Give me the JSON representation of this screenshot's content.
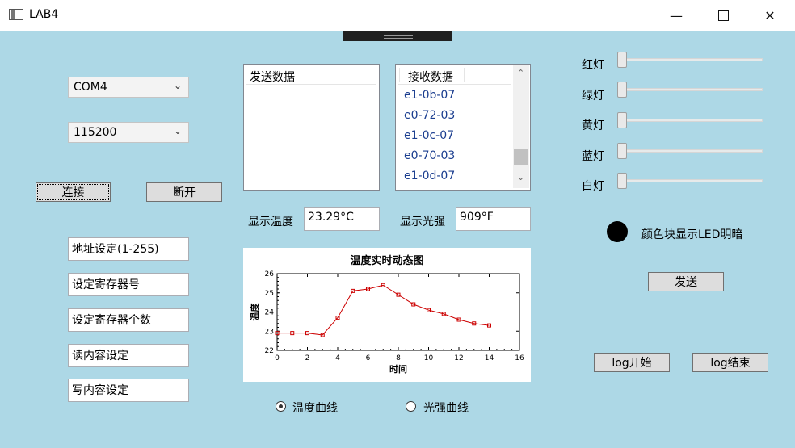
{
  "window": {
    "title": "LAB4"
  },
  "serial": {
    "port": "COM4",
    "baud": "115200",
    "connect_label": "连接",
    "disconnect_label": "断开"
  },
  "fields": {
    "address": "地址设定(1-255)",
    "register": "设定寄存器号",
    "register_count": "设定寄存器个数",
    "read_content": "读内容设定",
    "write_content": "写内容设定"
  },
  "send_list": {
    "header": "发送数据"
  },
  "receive_list": {
    "header": "接收数据",
    "items": [
      "e1-0b-07",
      "e0-72-03",
      "e1-0c-07",
      "e0-70-03",
      "e1-0d-07"
    ]
  },
  "readouts": {
    "temp_label": "显示温度",
    "temp_value": "23.29°C",
    "light_label": "显示光强",
    "light_value": "909°F"
  },
  "radios": {
    "temp_curve": "温度曲线",
    "light_curve": "光强曲线",
    "selected": "temp_curve"
  },
  "leds": {
    "red": "红灯",
    "green": "绿灯",
    "yellow": "黄灯",
    "blue": "蓝灯",
    "white": "白灯",
    "indicator_label": "颜色块显示LED明暗",
    "indicator_color": "#000000"
  },
  "buttons": {
    "send": "发送",
    "log_start": "log开始",
    "log_end": "log结束"
  },
  "chart_data": {
    "type": "line",
    "title": "温度实时动态图",
    "xlabel": "时间",
    "ylabel": "温度",
    "xlim": [
      0,
      16
    ],
    "ylim": [
      22,
      26
    ],
    "xticks": [
      "0",
      "2",
      "4",
      "6",
      "8",
      "10",
      "12",
      "14",
      "16"
    ],
    "yticks": [
      "22",
      "23",
      "24",
      "25",
      "26"
    ],
    "x": [
      0,
      1,
      2,
      3,
      4,
      5,
      6,
      7,
      8,
      9,
      10,
      11,
      12,
      13,
      14
    ],
    "y": [
      22.9,
      22.9,
      22.9,
      22.8,
      23.7,
      25.1,
      25.2,
      25.4,
      24.9,
      24.4,
      24.1,
      23.9,
      23.6,
      23.4,
      23.3
    ],
    "line_color": "#cc0000"
  }
}
